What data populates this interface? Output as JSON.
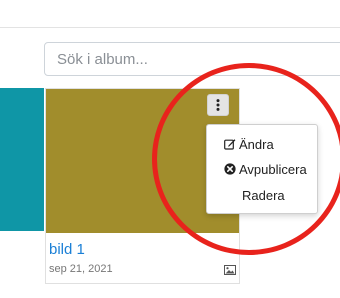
{
  "search": {
    "placeholder": "Sök i album..."
  },
  "album_card": {
    "title": "bild 1",
    "date": "sep 21, 2021",
    "thumbnail_color": "#a18d2c",
    "type_icon": "image-icon"
  },
  "side_card": {
    "color": "#0f96a6"
  },
  "context_menu": {
    "items": [
      {
        "label": "Ändra",
        "icon": "edit-icon"
      },
      {
        "label": "Avpublicera",
        "icon": "times-circle-icon"
      },
      {
        "label": "Radera",
        "icon": ""
      }
    ]
  },
  "highlight": {
    "color": "#e8231c"
  }
}
